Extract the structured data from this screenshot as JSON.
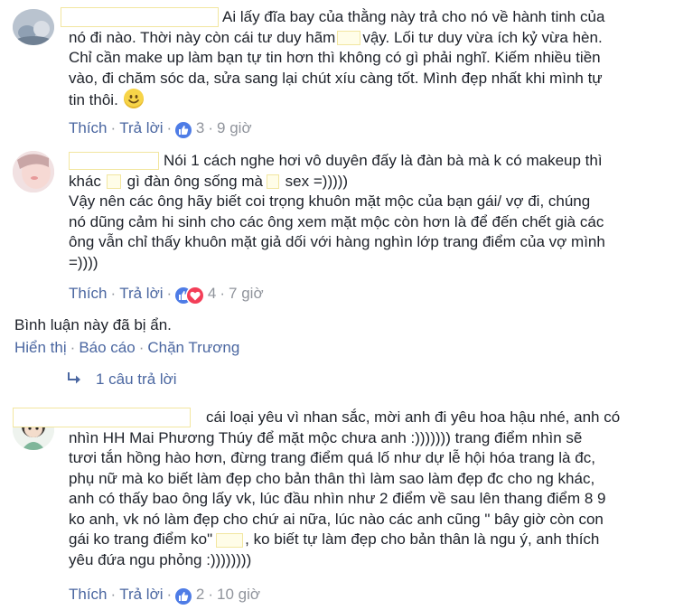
{
  "comments": [
    {
      "author_redacted": true,
      "lines": [
        "Ai lấy đĩa bay của thằng này trả cho nó về hành tinh của",
        "nó đi nào. Thời này còn cái tư duy hãm",
        "vậy. Lối tư duy vừa ích kỷ vừa hèn.",
        "Chỉ cần make up làm bạn tự tin hơn thì không có gì phải nghĩ. Kiếm nhiều tiền",
        "vào, đi chăm sóc da, sửa sang lại chút xíu càng tốt. Mình đẹp nhất khi mình tự",
        "tin thôi."
      ],
      "emoji": "smiley",
      "like_label": "Thích",
      "reply_label": "Trả lời",
      "reaction_count": "3",
      "time": "9 giờ"
    },
    {
      "author_redacted": true,
      "lines": [
        "Nói 1 cách nghe hơi vô duyên đấy là đàn bà mà k có makeup thì",
        "khác",
        "gì đàn ông sống mà",
        "sex =)))))",
        "Vậy nên các ông hãy biết coi trọng khuôn mặt mộc của bạn gái/ vợ đi, chúng",
        "nó dũng cảm hi sinh cho các ông xem mặt mộc còn hơn là để đến chết già các",
        "ông vẫn chỉ thấy khuôn mặt giả dối với hàng nghìn lớp trang điểm của vợ mình",
        "=))))"
      ],
      "like_label": "Thích",
      "reply_label": "Trả lời",
      "reaction_count": "4",
      "time": "7 giờ"
    },
    {
      "hidden_text": "Bình luận này đã bị ẩn.",
      "actions": [
        "Hiển thị",
        "Báo cáo",
        "Chặn Trương"
      ],
      "reply_count_label": "1 câu trả lời"
    },
    {
      "author_redacted": true,
      "lines": [
        "cái loại yêu vì nhan sắc, mời anh đi yêu hoa hậu nhé, anh có",
        "nhìn HH Mai Phương Thúy để mặt mộc chưa anh :))))))) trang điểm nhìn sẽ",
        "tươi tắn hồng hào hơn, đừng trang điểm quá lố như dự lễ hội hóa trang là đc,",
        "phụ nữ mà ko biết làm đẹp cho bản thân thì làm sao làm đẹp đc cho ng khác,",
        "anh có thấy bao ông lấy vk, lúc đầu nhìn như 2 điểm về sau lên thang điểm 8 9",
        "ko anh, vk nó làm đẹp cho chứ ai nữa, lúc nào các anh cũng \" bây giờ còn con",
        "gái ko trang điểm ko\"",
        ", ko biết tự làm đẹp cho bản thân là ngu ý, anh thích",
        "yêu đứa ngu phỏng :))))))))"
      ],
      "like_label": "Thích",
      "reply_label": "Trả lời",
      "reaction_count": "2",
      "time": "10 giờ"
    }
  ],
  "colors": {
    "text": "#1d2129",
    "link": "#4b67a1",
    "meta": "#90949c",
    "like": "#4e7ce6",
    "love": "#f33e58",
    "redact_border": "#f2e6a0"
  }
}
